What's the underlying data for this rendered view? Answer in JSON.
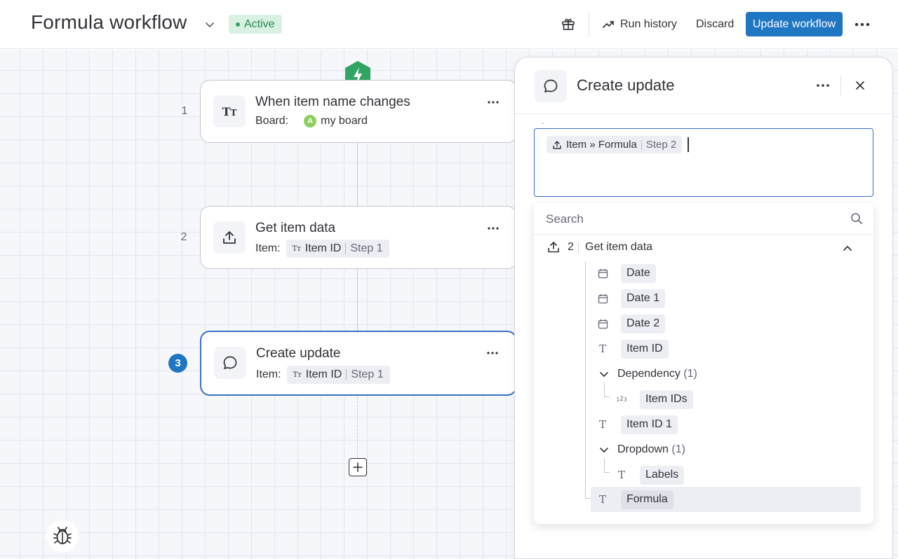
{
  "header": {
    "title": "Formula workflow",
    "status": "Active",
    "run_history_label": "Run history",
    "discard_label": "Discard",
    "update_label": "Update workflow"
  },
  "workflow": {
    "steps": [
      {
        "number": "1",
        "title": "When item name changes",
        "sub_label": "Board:",
        "board_initial": "A",
        "board_name": "my board"
      },
      {
        "number": "2",
        "title": "Get item data",
        "sub_label": "Item:",
        "chip_field": "Item ID",
        "chip_step": "Step 1"
      },
      {
        "number": "3",
        "title": "Create update",
        "sub_label": "Item:",
        "chip_field": "Item ID",
        "chip_step": "Step 1"
      }
    ]
  },
  "panel": {
    "title": "Create update",
    "field_dot": ".",
    "token": {
      "label": "Item » Formula",
      "step": "Step 2"
    },
    "search_placeholder": "Search",
    "group": {
      "number": "2",
      "label": "Get item data"
    },
    "items": [
      {
        "label": "Date",
        "icon": "calendar-icon"
      },
      {
        "label": "Date 1",
        "icon": "calendar-icon"
      },
      {
        "label": "Date 2",
        "icon": "calendar-icon"
      },
      {
        "label": "Item ID",
        "icon": "text-icon"
      },
      {
        "label": "Dependency",
        "count": "(1)",
        "icon": "chevron-down-icon"
      },
      {
        "label": "Item IDs",
        "icon": "numbers-icon"
      },
      {
        "label": "Item ID 1",
        "icon": "text-icon"
      },
      {
        "label": "Dropdown",
        "count": "(1)",
        "icon": "chevron-down-icon"
      },
      {
        "label": "Labels",
        "icon": "text-icon"
      },
      {
        "label": "Formula",
        "icon": "text-icon"
      }
    ]
  },
  "colors": {
    "primary": "#1f76c2",
    "active_badge_bg": "#d8f1e2",
    "active_badge_text": "#258750",
    "trigger_badge": "#2fa463"
  }
}
